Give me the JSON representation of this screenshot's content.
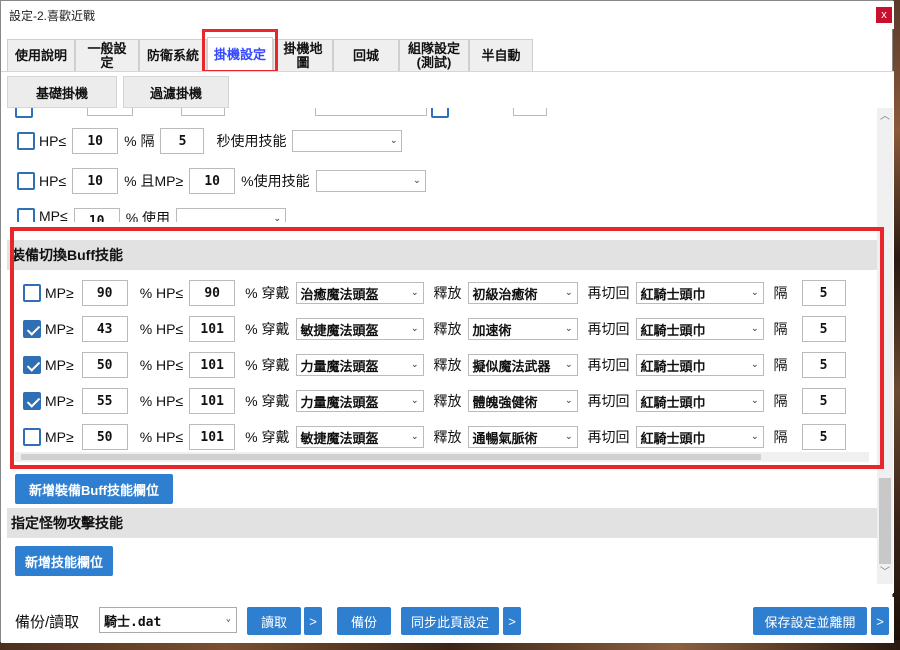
{
  "window": {
    "title": "設定-2.喜歡近戰",
    "close": "x"
  },
  "tabs": [
    {
      "label": "使用說明"
    },
    {
      "label": "一般設定"
    },
    {
      "label": "防衛系統"
    },
    {
      "label": "掛機設定"
    },
    {
      "label": "掛機地圖"
    },
    {
      "label": "回城"
    },
    {
      "label": "組隊設定\n(測試)"
    },
    {
      "label": "半自動"
    }
  ],
  "subtabs": [
    "基礎掛機",
    "過濾掛機"
  ],
  "upper_rows": {
    "row1": {
      "stat": "HP≤",
      "value": "10",
      "pct_gap": "% 隔",
      "seconds": "5",
      "suffix": "秒使用技能",
      "skill": ""
    },
    "row2": {
      "stat": "HP≤",
      "value": "10",
      "pct_and": "% 且MP≥",
      "mp": "10",
      "suffix": "%使用技能",
      "skill": ""
    },
    "row3": {
      "stat": "MP≤",
      "value": "10",
      "suffix": "% 使用",
      "skill": ""
    }
  },
  "buff_section": {
    "title": "裝備切換Buff技能",
    "labels": {
      "mp": "MP≥",
      "pct_hp": "% HP≤",
      "pct_wear": "% 穿戴",
      "release": "釋放",
      "switch_back": "再切回",
      "interval": "隔"
    },
    "rows": [
      {
        "checked": false,
        "mp": "90",
        "hp": "90",
        "equip": "治癒魔法頭盔",
        "skill": "初級治癒術",
        "back": "紅騎士頭巾",
        "gap": "5"
      },
      {
        "checked": true,
        "mp": "43",
        "hp": "101",
        "equip": "敏捷魔法頭盔",
        "skill": "加速術",
        "back": "紅騎士頭巾",
        "gap": "5"
      },
      {
        "checked": true,
        "mp": "50",
        "hp": "101",
        "equip": "力量魔法頭盔",
        "skill": "擬似魔法武器",
        "back": "紅騎士頭巾",
        "gap": "5"
      },
      {
        "checked": true,
        "mp": "55",
        "hp": "101",
        "equip": "力量魔法頭盔",
        "skill": "體魄強健術",
        "back": "紅騎士頭巾",
        "gap": "5"
      },
      {
        "checked": false,
        "mp": "50",
        "hp": "101",
        "equip": "敏捷魔法頭盔",
        "skill": "通暢氣脈術",
        "back": "紅騎士頭巾",
        "gap": "5"
      }
    ],
    "add_button": "新增裝備Buff技能欄位"
  },
  "monster_section": {
    "title": "指定怪物攻擊技能",
    "add_button": "新增技能欄位"
  },
  "bottom": {
    "caption": "備份/讀取",
    "file": "騎士.dat",
    "load": "讀取",
    "backup": "備份",
    "sync": "同步此頁設定",
    "save_exit": "保存設定並離開",
    "more": ">"
  },
  "colors": {
    "accent": "#2f7fd1",
    "highlight": "#e8262b",
    "active_tab": "#3348ff"
  }
}
